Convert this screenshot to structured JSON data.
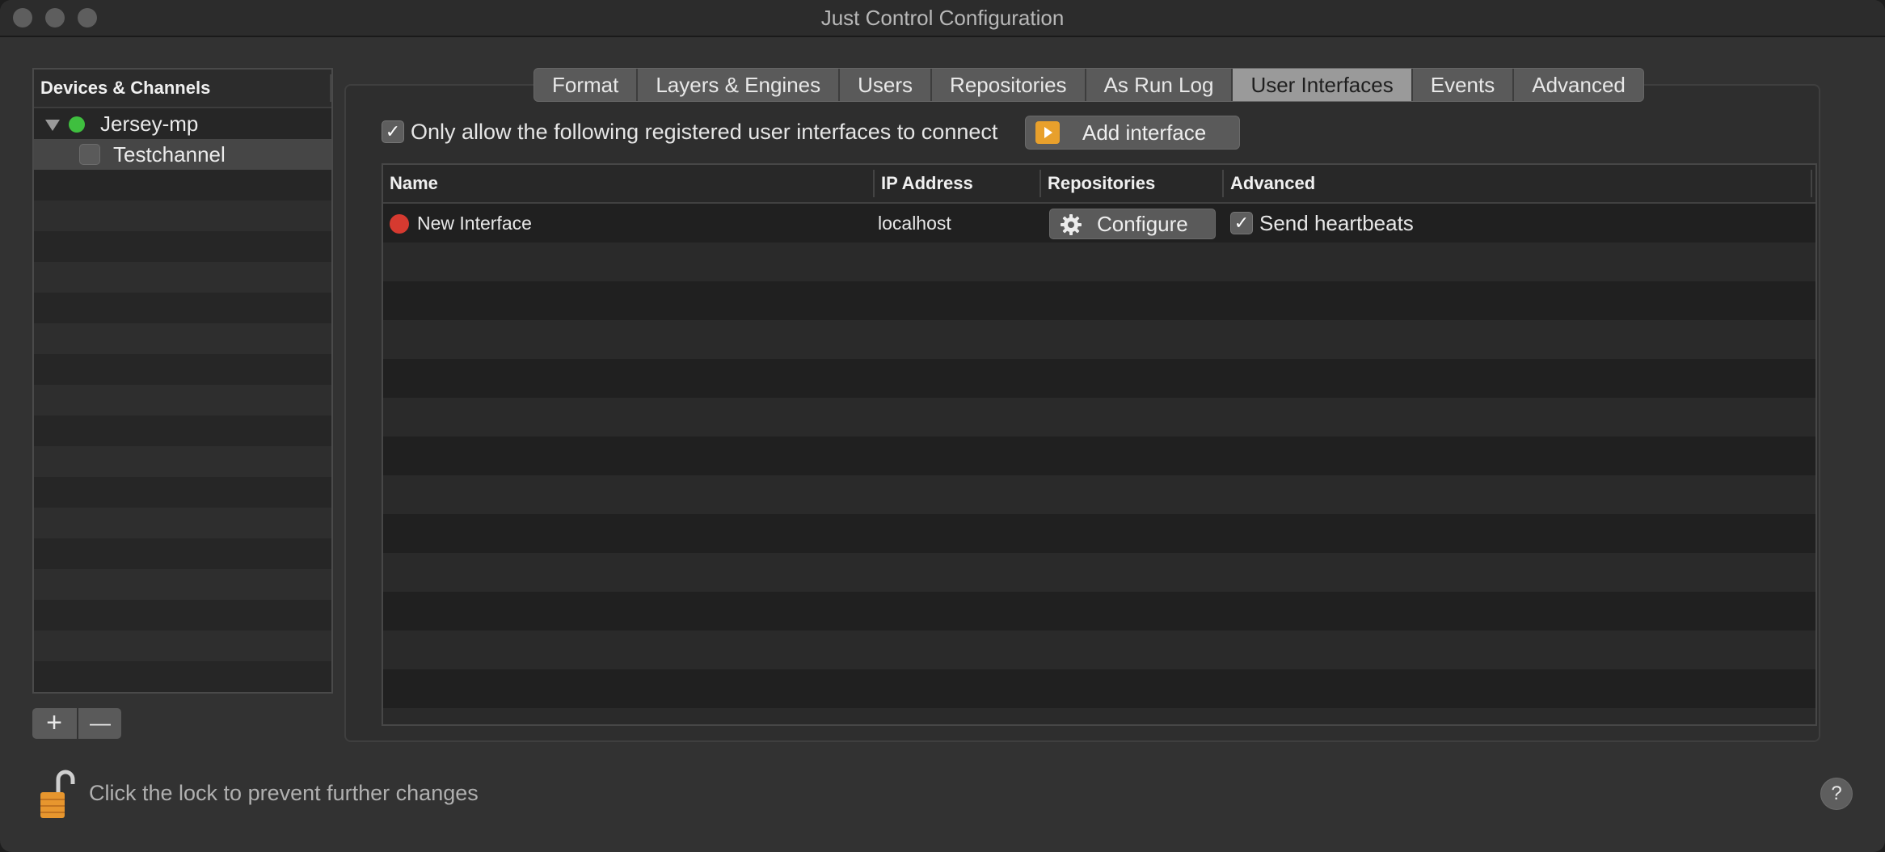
{
  "window": {
    "title": "Just Control Configuration"
  },
  "sidebar": {
    "header": "Devices & Channels",
    "items": [
      {
        "label": "Jersey-mp",
        "status_color": "#3fbf3f",
        "expanded": true
      },
      {
        "label": "Testchannel",
        "checked": false,
        "selected": true
      }
    ],
    "add_symbol": "+",
    "remove_symbol": "—"
  },
  "tabs": [
    "Format",
    "Layers & Engines",
    "Users",
    "Repositories",
    "As Run Log",
    "User Interfaces",
    "Events",
    "Advanced"
  ],
  "active_tab": "User Interfaces",
  "user_interfaces": {
    "allow_only_registered": {
      "checked": true,
      "label": "Only allow the following registered user interfaces to connect"
    },
    "add_button": {
      "label": "Add interface",
      "icon": "play-icon"
    },
    "table": {
      "columns": [
        "Name",
        "IP Address",
        "Repositories",
        "Advanced"
      ],
      "rows": [
        {
          "status_color": "#d63a30",
          "name": "New Interface",
          "ip": "localhost",
          "repositories_button": "Configure",
          "send_heartbeats": {
            "checked": true,
            "label": "Send heartbeats"
          }
        }
      ]
    }
  },
  "footer": {
    "lock_text": "Click the lock to prevent further changes",
    "lock_icon": "unlocked-padlock-icon",
    "help_label": "?"
  }
}
